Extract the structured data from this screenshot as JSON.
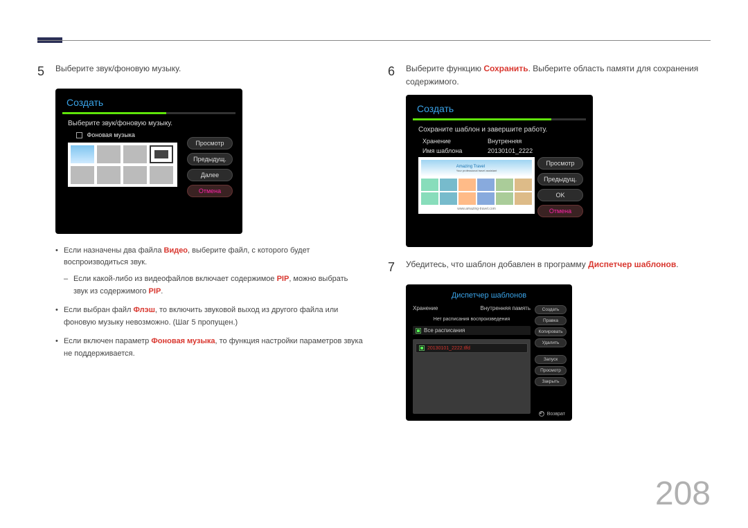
{
  "step5": {
    "num": "5",
    "text": "Выберите звук/фоновую музыку.",
    "panel": {
      "title": "Создать",
      "subhdr": "Выберите звук/фоновую музыку.",
      "bgmusic_label": "Фоновая музыка",
      "buttons": {
        "preview": "Просмотр",
        "prev": "Предыдущ.",
        "next": "Далее",
        "cancel": "Отмена"
      }
    },
    "notes": {
      "n1a": "Если назначены два файла ",
      "n1_video": "Видео",
      "n1b": ", выберите файл, с которого будет воспроизводиться звук.",
      "n1_suba": "Если какой-либо из видеофайлов включает содержимое ",
      "n1_pip": "PIP",
      "n1_subb": ", можно выбрать звук из содержимого ",
      "n1_subc": ".",
      "n2a": "Если выбран файл ",
      "n2_flash": "Флэш",
      "n2b": ", то включить звуковой выход из другого файла или фоновую музыку невозможно. (Шаг 5 пропущен.)",
      "n3a": "Если включен параметр ",
      "n3_bg": "Фоновая музыка",
      "n3b": ", то функция настройки параметров звука не поддерживается."
    }
  },
  "step6": {
    "num": "6",
    "text_a": "Выберите функцию ",
    "text_save": "Сохранить",
    "text_b": ". Выберите область памяти для сохранения содержимого.",
    "panel": {
      "title": "Создать",
      "subhdr": "Сохраните шаблон и завершите работу.",
      "storage_k": "Хранение",
      "storage_v": "Внутренняя",
      "name_k": "Имя шаблона",
      "name_v": "20130101_2222",
      "preview_banner": "Amazing Travel",
      "preview_sub": "Your professional travel assistant",
      "preview_url": "www.amazing-travel.com",
      "buttons": {
        "preview": "Просмотр",
        "prev": "Предыдущ.",
        "ok": "OK",
        "cancel": "Отмена"
      }
    }
  },
  "step7": {
    "num": "7",
    "text_a": "Убедитесь, что шаблон добавлен в программу ",
    "text_mgr": "Диспетчер шаблонов",
    "text_b": ".",
    "panel": {
      "title": "Диспетчер шаблонов",
      "storage_k": "Хранение",
      "storage_v": "Внутренняя память",
      "nolist": "Нет расписания воспроизведения",
      "all_schedules": "Все расписания",
      "file": "20130101_2222.tlfd",
      "buttons": {
        "create": "Создать",
        "edit": "Правка",
        "copy": "Копировать",
        "delete": "Удалить",
        "run": "Запуск",
        "preview": "Просмотр",
        "close": "Закрыть"
      },
      "return": "Возврат"
    }
  },
  "page_number": "208"
}
